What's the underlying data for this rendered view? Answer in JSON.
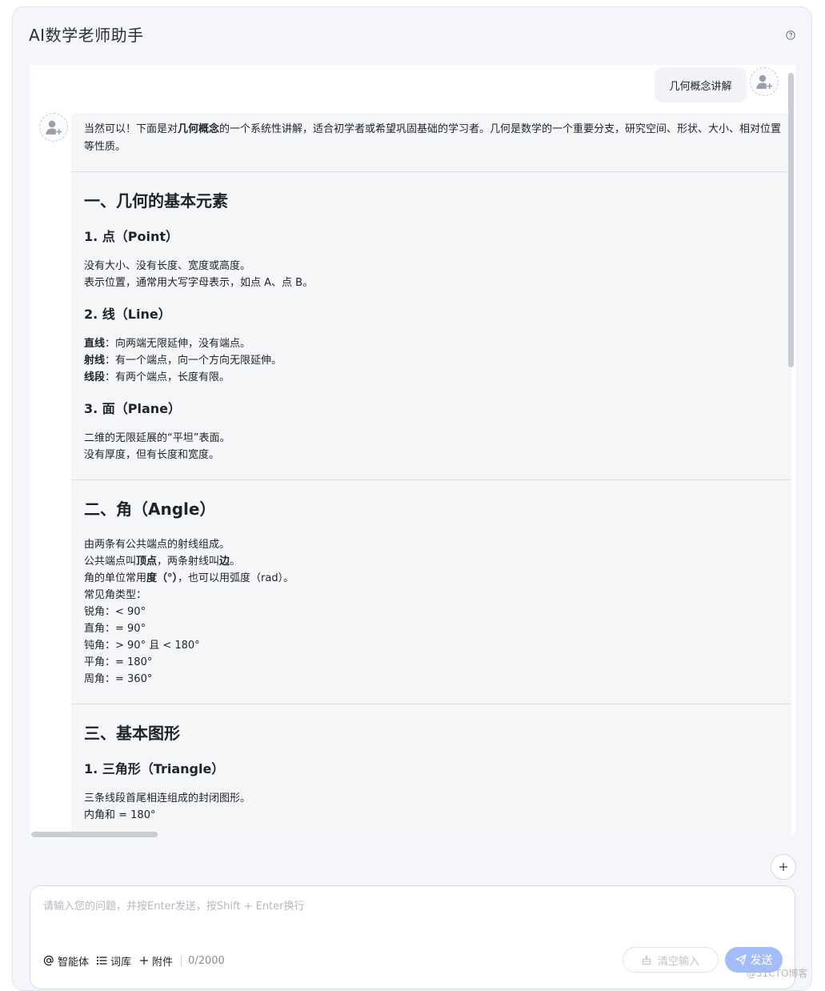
{
  "header": {
    "title": "AI数学老师助手",
    "help_icon": "help-circle-icon"
  },
  "user_message": "几何概念讲解",
  "ai_message": {
    "intro_before": "当然可以！下面是对",
    "intro_bold": "几何概念",
    "intro_after": "的一个系统性讲解，适合初学者或希望巩固基础的学习者。几何是数学的一个重要分支，研究空间、形状、大小、相对位置等性质。",
    "section1": {
      "title": "一、几何的基本元素",
      "point": {
        "title": "1. 点（Point）",
        "lines": [
          "没有大小、没有长度、宽度或高度。",
          "表示位置，通常用大写字母表示，如点 A、点 B。"
        ]
      },
      "line": {
        "title": "2. 线（Line）",
        "items": [
          {
            "term": "直线",
            "desc": "：向两端无限延伸，没有端点。"
          },
          {
            "term": "射线",
            "desc": "：有一个端点，向一个方向无限延伸。"
          },
          {
            "term": "线段",
            "desc": "：有两个端点，长度有限。"
          }
        ]
      },
      "plane": {
        "title": "3. 面（Plane）",
        "lines": [
          "二维的无限延展的“平坦”表面。",
          "没有厚度，但有长度和宽度。"
        ]
      }
    },
    "section2": {
      "title": "二、角（Angle）",
      "line1": "由两条有公共端点的射线组成。",
      "line2_a": "公共端点叫",
      "line2_b": "顶点",
      "line2_c": "，两条射线叫",
      "line2_d": "边",
      "line2_e": "。",
      "line3_a": "角的单位常用",
      "line3_b": "度（°）",
      "line3_c": "，也可以用弧度（rad）。",
      "line4": "常见角类型：",
      "types": [
        "锐角：< 90°",
        "直角：= 90°",
        "钝角：> 90° 且 < 180°",
        "平角：= 180°",
        "周角：= 360°"
      ]
    },
    "section3": {
      "title": "三、基本图形",
      "triangle": {
        "title": "1. 三角形（Triangle）",
        "lines": [
          "三条线段首尾相连组成的封闭图形。",
          "内角和 = 180°"
        ]
      }
    }
  },
  "input": {
    "placeholder": "请输入您的问题，并按Enter发送，按Shift + Enter换行",
    "value": "",
    "counter": "0/2000"
  },
  "toolbar": {
    "agent_label": "智能体",
    "lexicon_label": "词库",
    "attach_label": "附件",
    "clear_label": "清空输入",
    "send_label": "发送"
  },
  "watermark": "@51CTO博客"
}
